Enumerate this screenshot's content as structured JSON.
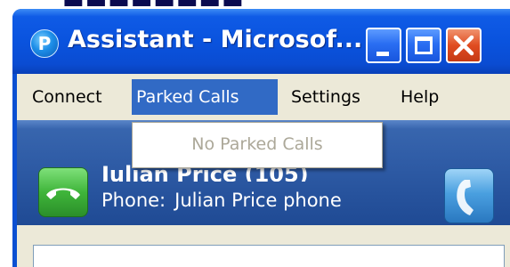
{
  "window": {
    "title": "Assistant - Microsof...",
    "icon": "assistant-app-icon",
    "buttons": [
      "minimize",
      "maximize",
      "close"
    ]
  },
  "menubar": {
    "items": [
      {
        "label": "Connect"
      },
      {
        "label": "Parked Calls",
        "active": true
      },
      {
        "label": "Settings"
      },
      {
        "label": "Help"
      }
    ]
  },
  "parked_calls_menu": {
    "items": [
      {
        "label": "No Parked Calls",
        "enabled": false
      }
    ]
  },
  "contact": {
    "name": "Julian Price (105)",
    "phone_label": "Phone:",
    "phone_value": "Julian Price phone",
    "left_icon": "hang-up-icon",
    "right_icon": "handset-icon"
  },
  "colors": {
    "titlebar": "#0a53de",
    "menu_highlight": "#316ac5",
    "panel": "#2f5ca6",
    "close_button": "#e04c21",
    "disabled_text": "#aca899"
  }
}
